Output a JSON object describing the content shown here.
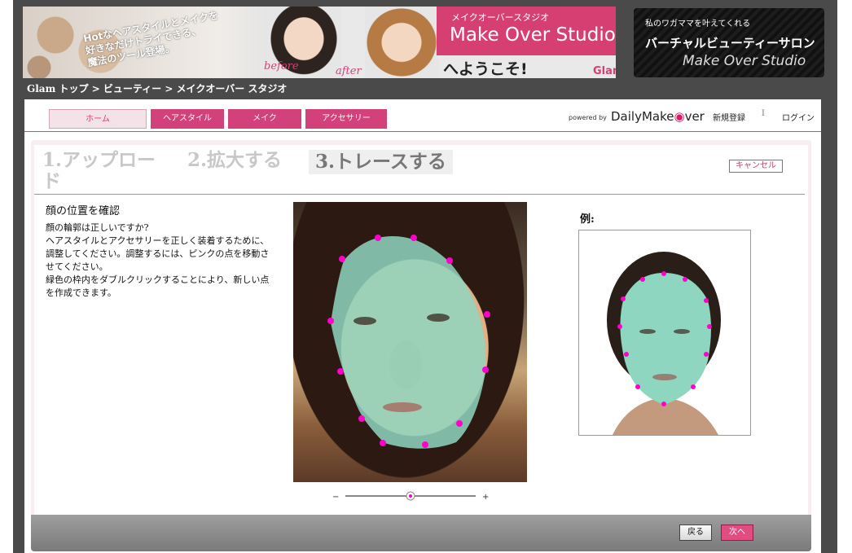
{
  "banner": {
    "tagline_line1": "Hotなヘアスタイルとメイクを",
    "tagline_line2": "好きなだけトライできる、",
    "tagline_line3": "魔法のツール登場。",
    "before_label": "before",
    "after_label": "after",
    "studio_small": "メイクオーバースタジオ",
    "studio_large": "Make Over Studio",
    "welcome": "へようこそ!",
    "glam_logo": "Glam"
  },
  "salon_banner": {
    "line1": "私のワガママを叶えてくれる",
    "line2": "バーチャルビューティーサロン",
    "line3": "Make Over Studio"
  },
  "breadcrumb": "Glam トップ > ビューティー > メイクオーバー スタジオ",
  "nav": {
    "tabs": [
      {
        "label": "ホーム"
      },
      {
        "label": "ヘアスタイル"
      },
      {
        "label": "メイク"
      },
      {
        "label": "アクセサリー"
      }
    ],
    "powered_by": "powered by",
    "brand_a": "DailyMake",
    "brand_b": "ver",
    "register": "新規登録",
    "separator": "I",
    "login": "ログイン"
  },
  "steps": {
    "step1": "1.アップロード",
    "step2": "2.拡大する",
    "step3": "3.トレースする",
    "cancel": "キャンセル"
  },
  "main": {
    "heading": "顔の位置を確認",
    "description": [
      "顔の輪郭は正しいですか?",
      "ヘアスタイルとアクセサリーを正しく装着するために、調整してください。調整するには、ピンクの点を移動させてください。",
      "緑色の枠内をダブルクリックすることにより、新しい点を作成できます。"
    ],
    "example_label": "例:"
  },
  "zoom": {
    "minus": "−",
    "plus": "+",
    "level": 0.5
  },
  "footer": {
    "back": "戻る",
    "next": "次へ"
  },
  "colors": {
    "accent": "#d3417a",
    "trace_fill": "#8fd6c0",
    "trace_point": "#ff00cc"
  }
}
